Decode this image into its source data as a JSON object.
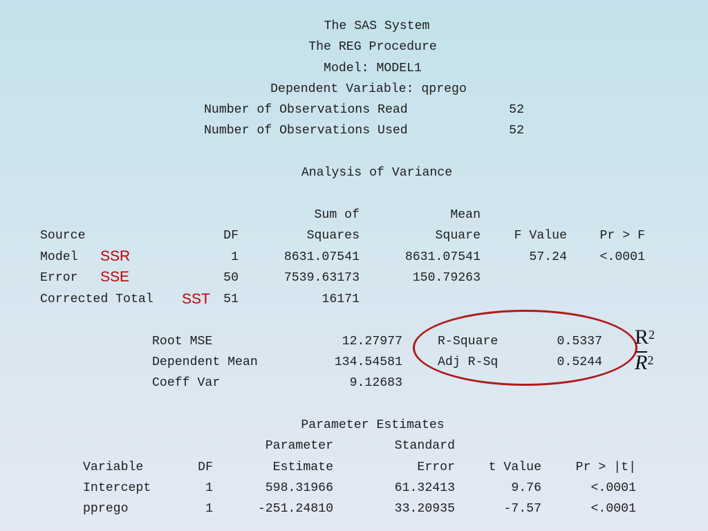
{
  "header": {
    "system": "The SAS System",
    "procedure": "The REG Procedure",
    "model": "Model: MODEL1",
    "dependent": "Dependent Variable: qprego",
    "obs_read_label": "Number of Observations Read",
    "obs_read_value": "52",
    "obs_used_label": "Number of Observations Used",
    "obs_used_value": "52"
  },
  "anova": {
    "title": "Analysis of Variance",
    "headers": {
      "source": "Source",
      "df": "DF",
      "ss_top": "Sum of",
      "ss_bottom": "Squares",
      "ms_top": "Mean",
      "ms_bottom": "Square",
      "f": "F Value",
      "p": "Pr > F"
    },
    "rows": [
      {
        "source": "Model",
        "tag": "SSR",
        "df": "1",
        "ss": "8631.07541",
        "ms": "8631.07541",
        "f": "57.24",
        "p": "<.0001"
      },
      {
        "source": "Error",
        "tag": "SSE",
        "df": "50",
        "ss": "7539.63173",
        "ms": "150.79263",
        "f": "",
        "p": ""
      },
      {
        "source": "Corrected Total",
        "tag": "SST",
        "df": "51",
        "ss": "16171",
        "ms": "",
        "f": "",
        "p": ""
      }
    ]
  },
  "fit": {
    "root_mse_label": "Root MSE",
    "root_mse": "12.27977",
    "dep_mean_label": "Dependent Mean",
    "dep_mean": "134.54581",
    "coeff_var_label": "Coeff Var",
    "coeff_var": "9.12683",
    "rsq_label": "R-Square",
    "rsq": "0.5337",
    "adjrsq_label": "Adj R-Sq",
    "adjrsq": "0.5244"
  },
  "annotation": {
    "r_letter": "R",
    "r_exp": "2",
    "rbar_letter": "R",
    "rbar_exp": "2",
    "accent_color": "#c00000"
  },
  "params": {
    "title": "Parameter Estimates",
    "headers": {
      "variable": "Variable",
      "df": "DF",
      "est_top": "Parameter",
      "est_bottom": "Estimate",
      "se_top": "Standard",
      "se_bottom": "Error",
      "t": "t Value",
      "p": "Pr > |t|"
    },
    "rows": [
      {
        "variable": "Intercept",
        "df": "1",
        "est": "598.31966",
        "se": "61.32413",
        "t": "9.76",
        "p": "<.0001"
      },
      {
        "variable": "pprego",
        "df": "1",
        "est": "-251.24810",
        "se": "33.20935",
        "t": "-7.57",
        "p": "<.0001"
      }
    ]
  }
}
